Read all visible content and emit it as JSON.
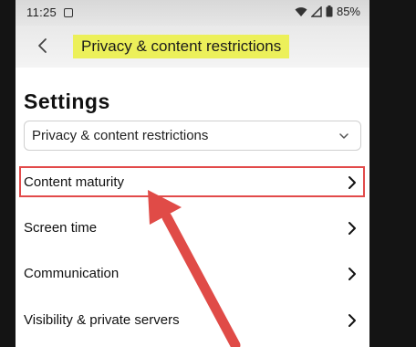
{
  "status_bar": {
    "time": "11:25",
    "battery": "85%"
  },
  "header": {
    "back_icon": "chevron-left-icon",
    "title": "Privacy & content restrictions",
    "title_highlight_color": "#ecf05a"
  },
  "page": {
    "title": "Settings",
    "dropdown_value": "Privacy & content restrictions"
  },
  "menu": {
    "items": [
      {
        "label": "Content maturity"
      },
      {
        "label": "Screen time"
      },
      {
        "label": "Communication"
      },
      {
        "label": "Visibility & private servers"
      }
    ]
  },
  "annotation": {
    "box_color": "#e24a4a",
    "arrow_color": "#e04b47"
  }
}
